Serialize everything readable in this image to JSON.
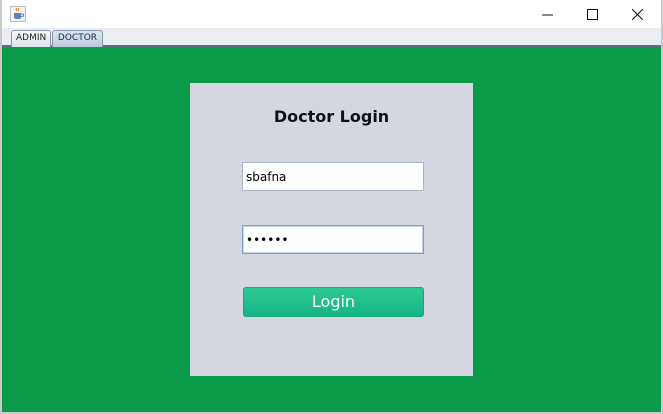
{
  "window": {
    "controls": {
      "minimize_icon": "minimize-icon",
      "maximize_icon": "maximize-icon",
      "close_icon": "close-icon"
    },
    "app_icon": "java-cup-icon"
  },
  "tabs": [
    {
      "label": "ADMIN",
      "selected": false
    },
    {
      "label": "DOCTOR",
      "selected": true
    }
  ],
  "login": {
    "title": "Doctor Login",
    "username_value": "sbafna",
    "password_value": "••••••",
    "button_label": "Login"
  },
  "colors": {
    "background": "#0a9a4a",
    "panel": "#d5d7e0",
    "button": "#1cbd8a"
  }
}
